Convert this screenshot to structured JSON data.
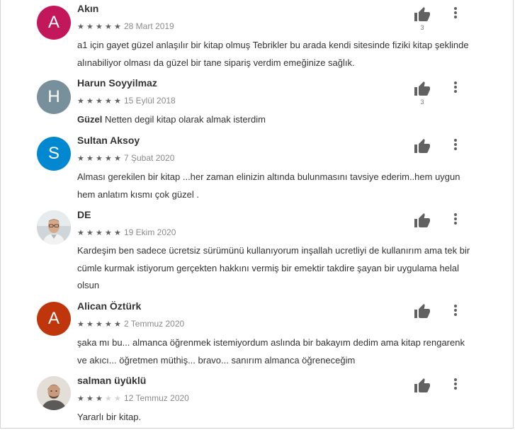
{
  "reviews": [
    {
      "initial": "A",
      "avatar_color": "#c2185b",
      "name": "Akın",
      "rating": 5,
      "date": "28 Mart 2019",
      "title": "",
      "text": "a1 için gayet güzel anlaşılır bir kitap olmuş Tebrikler bu arada kendi sitesinde fiziki kitap şeklinde alınabiliyor olması da güzel bir tane sipariş verdim emeğinize sağlık.",
      "helpful_count": "3",
      "thumb_icon": "thumbs-up-icon",
      "more_icon": "more-vertical-icon"
    },
    {
      "initial": "H",
      "avatar_color": "#78909c",
      "name": "Harun Soyyilmaz",
      "rating": 5,
      "date": "15 Eylül 2018",
      "title": "Güzel",
      "text": "Netten degil kitap olarak almak isterdim",
      "helpful_count": "3",
      "thumb_icon": "thumbs-up-icon",
      "more_icon": "more-vertical-icon"
    },
    {
      "initial": "S",
      "avatar_color": "#0288d1",
      "name": "Sultan Aksoy",
      "rating": 5,
      "date": "7 Şubat 2020",
      "title": "",
      "text": "Alması gerekilen bir kitap ...her zaman elinizin altında bulunmasını tavsiye ederim..hem uygun hem anlatım kısmı çok güzel .",
      "helpful_count": "",
      "thumb_icon": "thumbs-up-icon",
      "more_icon": "more-vertical-icon"
    },
    {
      "initial": "",
      "avatar_color": "#dfe3e6",
      "name": "DE",
      "rating": 5,
      "date": "19 Ekim 2020",
      "title": "",
      "text": "Kardeşim ben sadece ücretsiz sürümünü kullanıyorum inşallah ucretliyi de kullanırım ama tek bir cümle kurmak istiyorum gerçekten hakkını vermiş bir emektir takdire şayan bir uygulama helal olsun",
      "helpful_count": "",
      "thumb_icon": "thumbs-up-icon",
      "more_icon": "more-vertical-icon"
    },
    {
      "initial": "A",
      "avatar_color": "#bf360c",
      "name": "Alican Öztürk",
      "rating": 5,
      "date": "2 Temmuz 2020",
      "title": "",
      "text": "şaka mı bu... almanca öğrenmek istemiyordum aslında bir bakayım dedim ama kitap rengarenk ve akıcı... öğretmen müthiş... bravo... sanırım almanca öğreneceğim",
      "helpful_count": "",
      "thumb_icon": "thumbs-up-icon",
      "more_icon": "more-vertical-icon"
    },
    {
      "initial": "",
      "avatar_color": "#d9d4cc",
      "name": "salman üyüklü",
      "rating": 3,
      "date": "12 Temmuz 2020",
      "title": "",
      "text": "Yararlı bir kitap.",
      "helpful_count": "",
      "thumb_icon": "thumbs-up-icon",
      "more_icon": "more-vertical-icon"
    }
  ]
}
